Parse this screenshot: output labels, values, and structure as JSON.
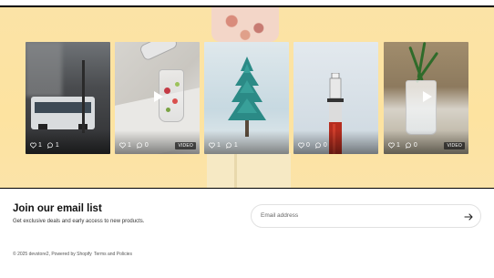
{
  "gallery": {
    "items": [
      {
        "likes": "1",
        "comments": "1",
        "is_video": false
      },
      {
        "likes": "1",
        "comments": "0",
        "is_video": true,
        "badge": "VIDEO"
      },
      {
        "likes": "1",
        "comments": "1",
        "is_video": false
      },
      {
        "likes": "0",
        "comments": "0",
        "is_video": false
      },
      {
        "likes": "1",
        "comments": "0",
        "is_video": true,
        "badge": "VIDEO"
      }
    ]
  },
  "signup": {
    "title": "Join our email list",
    "subtitle": "Get exclusive deals and early access to new products.",
    "email_placeholder": "Email address"
  },
  "footer": {
    "copyright": "© 2025 devstore2, Powered by Shopify",
    "policies_link": "Terms and Policies"
  },
  "colors": {
    "banner": "#fde3a0",
    "text": "#1a1a1a"
  },
  "icons": [
    "heart-icon",
    "comment-icon",
    "play-icon",
    "arrow-right-icon"
  ]
}
